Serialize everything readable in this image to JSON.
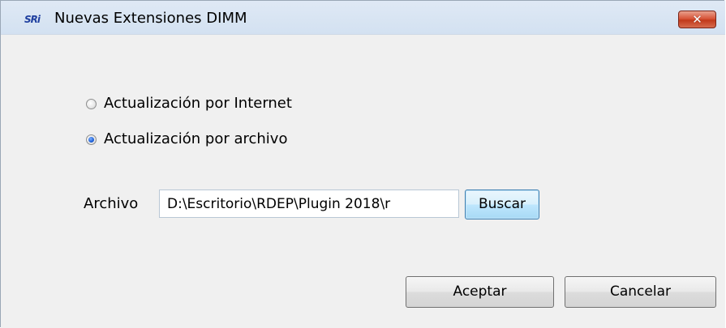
{
  "window": {
    "title": "Nuevas Extensiones DIMM",
    "app_icon_text": "SRi",
    "close_label": "✕"
  },
  "options": {
    "internet_label": "Actualización por Internet",
    "archivo_label": "Actualización por archivo",
    "selected": "archivo"
  },
  "file": {
    "label": "Archivo",
    "value": "D:\\Escritorio\\RDEP\\Plugin 2018\\r",
    "browse_label": "Buscar"
  },
  "footer": {
    "accept_label": "Aceptar",
    "cancel_label": "Cancelar"
  },
  "colors": {
    "close_button": "#c1391b",
    "radio_selected": "#1c5fd6",
    "focus_border": "#3c7fb1"
  }
}
